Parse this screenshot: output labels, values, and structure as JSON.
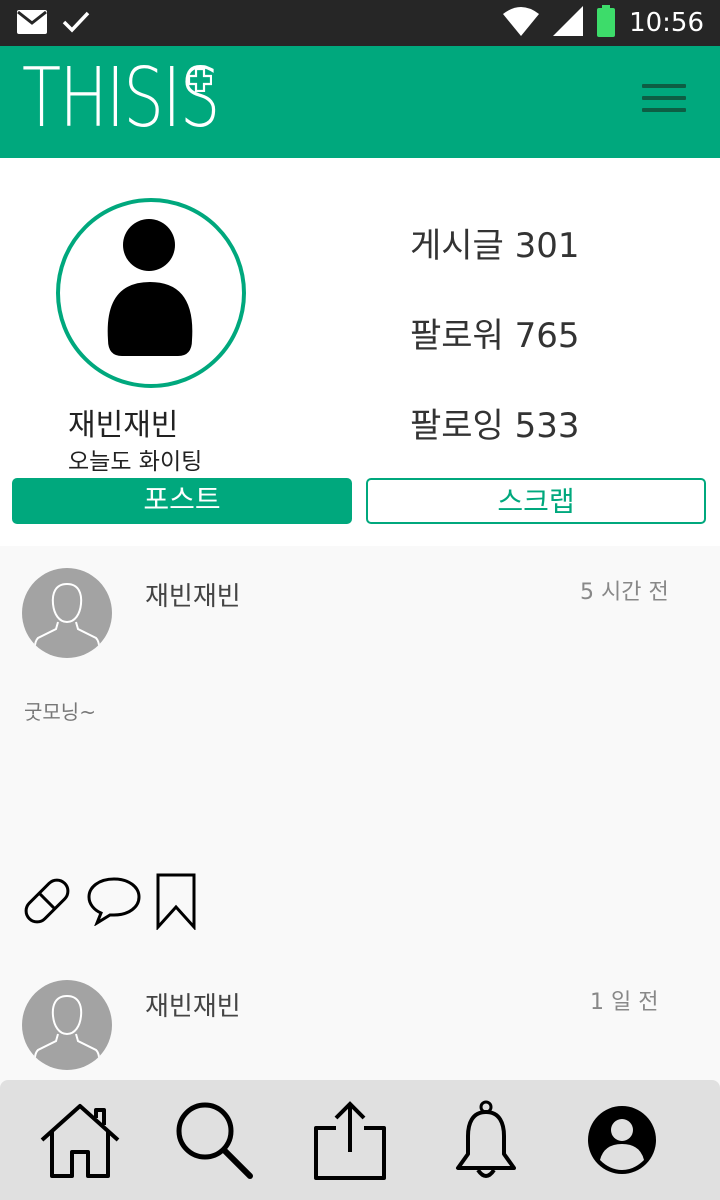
{
  "status_bar": {
    "time": "10:56",
    "icons": [
      "mail-icon",
      "check-icon",
      "wifi-icon",
      "signal-icon",
      "battery-icon"
    ]
  },
  "app": {
    "logo_text": "THISIS",
    "logo_icon": "plus-icon",
    "menu_icon": "hamburger-icon",
    "accent_color": "#00a87d"
  },
  "profile": {
    "name": "재빈재빈",
    "status": "오늘도 화이팅",
    "stats": {
      "posts": "게시글 301",
      "followers": "팔로워 765",
      "following": "팔로잉 533"
    },
    "tabs": {
      "post": "포스트",
      "scrap": "스크랩"
    }
  },
  "feed": [
    {
      "user": "재빈재빈",
      "time": "5 시간 전",
      "text": "굿모닝~",
      "actions": [
        "pill-icon",
        "comment-icon",
        "bookmark-icon"
      ]
    },
    {
      "user": "재빈재빈",
      "time": "1 일 전"
    }
  ],
  "bottom_nav": [
    "home-icon",
    "search-icon",
    "share-icon",
    "bell-icon",
    "profile-icon"
  ]
}
